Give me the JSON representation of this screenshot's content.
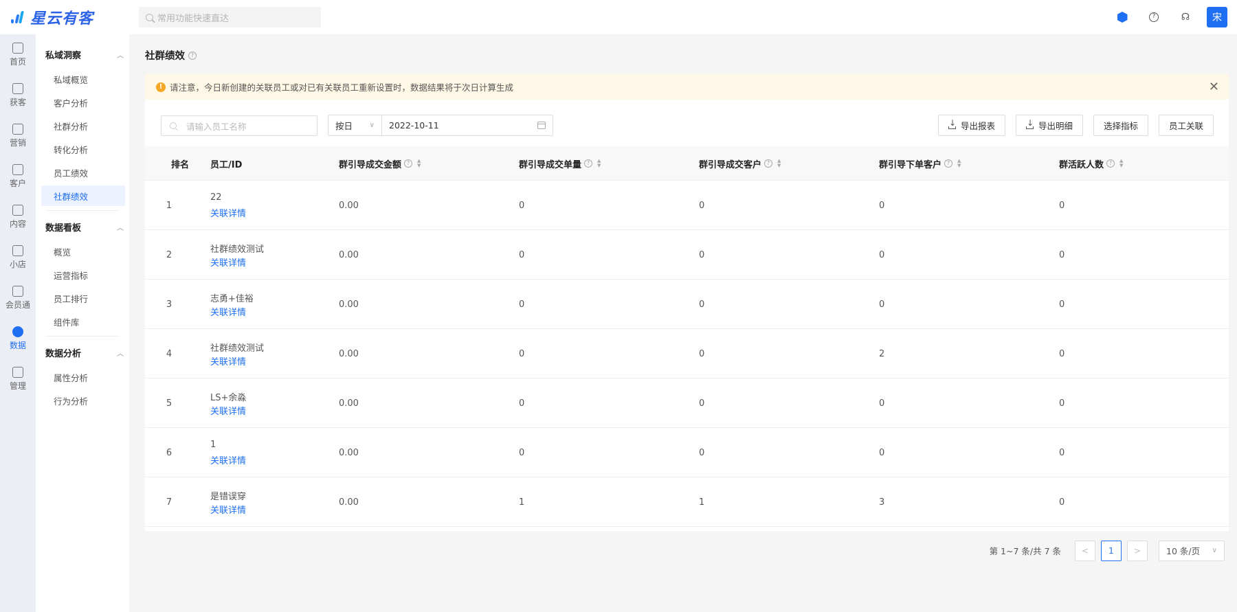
{
  "brand": {
    "name": "星云有客"
  },
  "top_search": {
    "placeholder": "常用功能快速直达"
  },
  "user": {
    "avatar_text": "宋"
  },
  "rail": [
    {
      "label": "首页",
      "icon": "home-icon"
    },
    {
      "label": "获客",
      "icon": "user-add-icon"
    },
    {
      "label": "营销",
      "icon": "bulb-icon"
    },
    {
      "label": "客户",
      "icon": "user-icon"
    },
    {
      "label": "内容",
      "icon": "folder-icon"
    },
    {
      "label": "小店",
      "icon": "shop-icon"
    },
    {
      "label": "会员通",
      "icon": "member-icon"
    },
    {
      "label": "数据",
      "icon": "pie-chart-icon",
      "active": true
    },
    {
      "label": "管理",
      "icon": "apps-icon"
    }
  ],
  "submenu": {
    "groups": [
      {
        "title": "私域洞察",
        "items": [
          "私域概览",
          "客户分析",
          "社群分析",
          "转化分析",
          "员工绩效",
          "社群绩效"
        ]
      },
      {
        "title": "数据看板",
        "items": [
          "概览",
          "运营指标",
          "员工排行",
          "组件库"
        ]
      },
      {
        "title": "数据分析",
        "items": [
          "属性分析",
          "行为分析"
        ]
      }
    ],
    "active_item": "社群绩效"
  },
  "page": {
    "title": "社群绩效"
  },
  "notice": {
    "text": "请注意，今日新创建的关联员工或对已有关联员工重新设置时，数据结果将于次日计算生成"
  },
  "filters": {
    "employee_placeholder": "请输入员工名称",
    "period": "按日",
    "date": "2022-10-11"
  },
  "actions": {
    "export_report": "导出报表",
    "export_detail": "导出明细",
    "select_metrics": "选择指标",
    "employee_link": "员工关联"
  },
  "table": {
    "headers": {
      "rank": "排名",
      "employee": "员工/ID",
      "gmv": "群引导成交金额",
      "orders": "群引导成交单量",
      "buyers": "群引导成交客户",
      "order_customers": "群引导下单客户",
      "active": "群活跃人数"
    },
    "link_label": "关联详情",
    "rows": [
      {
        "rank": "1",
        "name": "22",
        "gmv": "0.00",
        "orders": "0",
        "buyers": "0",
        "order_customers": "0",
        "active": "0"
      },
      {
        "rank": "2",
        "name": "社群绩效测试",
        "gmv": "0.00",
        "orders": "0",
        "buyers": "0",
        "order_customers": "0",
        "active": "0"
      },
      {
        "rank": "3",
        "name": "志勇+佳裕",
        "gmv": "0.00",
        "orders": "0",
        "buyers": "0",
        "order_customers": "0",
        "active": "0"
      },
      {
        "rank": "4",
        "name": "社群绩效测试",
        "gmv": "0.00",
        "orders": "0",
        "buyers": "0",
        "order_customers": "2",
        "active": "0"
      },
      {
        "rank": "5",
        "name": "LS+余淼",
        "gmv": "0.00",
        "orders": "0",
        "buyers": "0",
        "order_customers": "0",
        "active": "0"
      },
      {
        "rank": "6",
        "name": "1",
        "gmv": "0.00",
        "orders": "0",
        "buyers": "0",
        "order_customers": "0",
        "active": "0"
      },
      {
        "rank": "7",
        "name": "是错误穿",
        "gmv": "0.00",
        "orders": "1",
        "buyers": "1",
        "order_customers": "3",
        "active": "0"
      }
    ]
  },
  "pagination": {
    "total_text": "第 1~7 条/共 7 条",
    "current_page": "1",
    "page_size": "10 条/页",
    "prev": "<",
    "next": ">"
  },
  "colors": {
    "accent": "#1f6ff2",
    "notice_bg": "#fff8e6",
    "warning": "#f5a623"
  }
}
